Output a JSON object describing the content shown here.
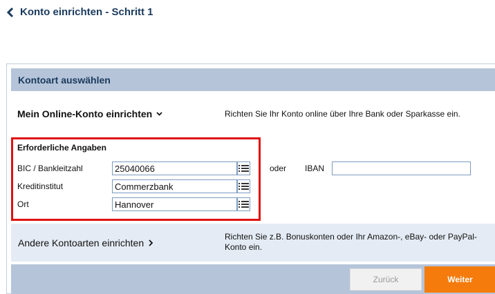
{
  "header": {
    "title": "Konto einrichten - Schritt 1"
  },
  "section": {
    "title": "Kontoart auswählen"
  },
  "online_account": {
    "title": "Mein Online-Konto einrichten",
    "description": "Richten Sie Ihr Konto online über Ihre Bank oder Sparkasse ein."
  },
  "required_fields": {
    "title": "Erforderliche Angaben",
    "bic_label": "BIC / Bankleitzahl",
    "bic_value": "25040066",
    "bank_label": "Kreditinstitut",
    "bank_value": "Commerzbank",
    "city_label": "Ort",
    "city_value": "Hannover",
    "or_label": "oder",
    "iban_label": "IBAN",
    "iban_value": ""
  },
  "other_accounts": {
    "title": "Andere Kontoarten einrichten",
    "description": "Richten Sie z.B. Bonuskonten oder Ihr Amazon-, eBay- oder PayPal-Konto ein."
  },
  "footer": {
    "back_label": "Zurück",
    "next_label": "Weiter"
  },
  "colors": {
    "title_blue": "#1a3a5c",
    "header_bar": "#b5c4d9",
    "highlight_border": "#e01010",
    "primary_button": "#f47b0c",
    "secondary_row": "#e4ebf4"
  }
}
